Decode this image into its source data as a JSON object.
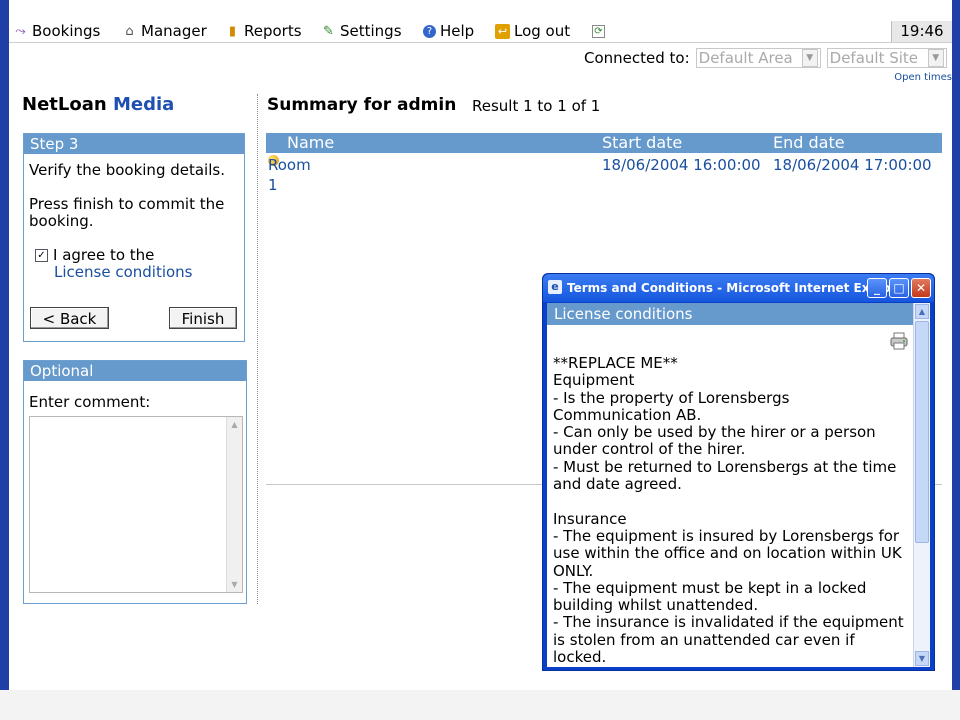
{
  "menubar": {
    "items": [
      {
        "label": "Bookings",
        "icon": "bookings-icon",
        "glyph": "⤳"
      },
      {
        "label": "Manager",
        "icon": "manager-icon",
        "glyph": "⌂"
      },
      {
        "label": "Reports",
        "icon": "reports-icon",
        "glyph": "▮"
      },
      {
        "label": "Settings",
        "icon": "settings-icon",
        "glyph": "✎"
      },
      {
        "label": "Help",
        "icon": "help-icon",
        "glyph": "?"
      },
      {
        "label": "Log out",
        "icon": "logout-icon",
        "glyph": "↩"
      }
    ],
    "refresh_glyph": "⟳",
    "clock": "19:46"
  },
  "connection": {
    "label": "Connected to:",
    "area": "Default Area",
    "site": "Default Site",
    "open_times": "Open times"
  },
  "logo": {
    "part1": "NetLoan",
    "part2": "Media"
  },
  "step_panel": {
    "title": "Step 3",
    "text1": "Verify the booking details.",
    "text2": "Press finish to commit the booking.",
    "agree_label": "I agree to the",
    "agree_checked": true,
    "license_link": "License conditions",
    "back_label": "< Back",
    "finish_label": "Finish"
  },
  "optional_panel": {
    "title": "Optional",
    "comment_label": "Enter comment:",
    "comment_value": ""
  },
  "summary": {
    "title": "Summary for admin",
    "result": "Result 1 to 1 of 1",
    "columns": {
      "name": "Name",
      "start": "Start date",
      "end": "End date"
    },
    "rows": [
      {
        "name": "Room 1",
        "start": "18/06/2004 16:00:00",
        "end": "18/06/2004 17:00:00"
      }
    ]
  },
  "popup": {
    "title": "Terms and Conditions - Microsoft Internet Explo...",
    "header": "License conditions",
    "body": "**REPLACE ME**\nEquipment\n- Is the property of Lorensbergs Communication AB.\n- Can only be used by the hirer or a person under control of the hirer.\n- Must be returned to Lorensbergs at the time and date agreed.\n\nInsurance\n- The equipment is insured by Lorensbergs for use within the office and on location within UK ONLY.\n- The equipment must be kept in a locked building whilst unattended.\n- The insurance is invalidated if the equipment is stolen from an unattended car even if locked."
  },
  "colors": {
    "accent": "#6699cc",
    "link": "#1a4fa0",
    "frame": "#1f3fa6",
    "titlebar": "#1656de"
  }
}
